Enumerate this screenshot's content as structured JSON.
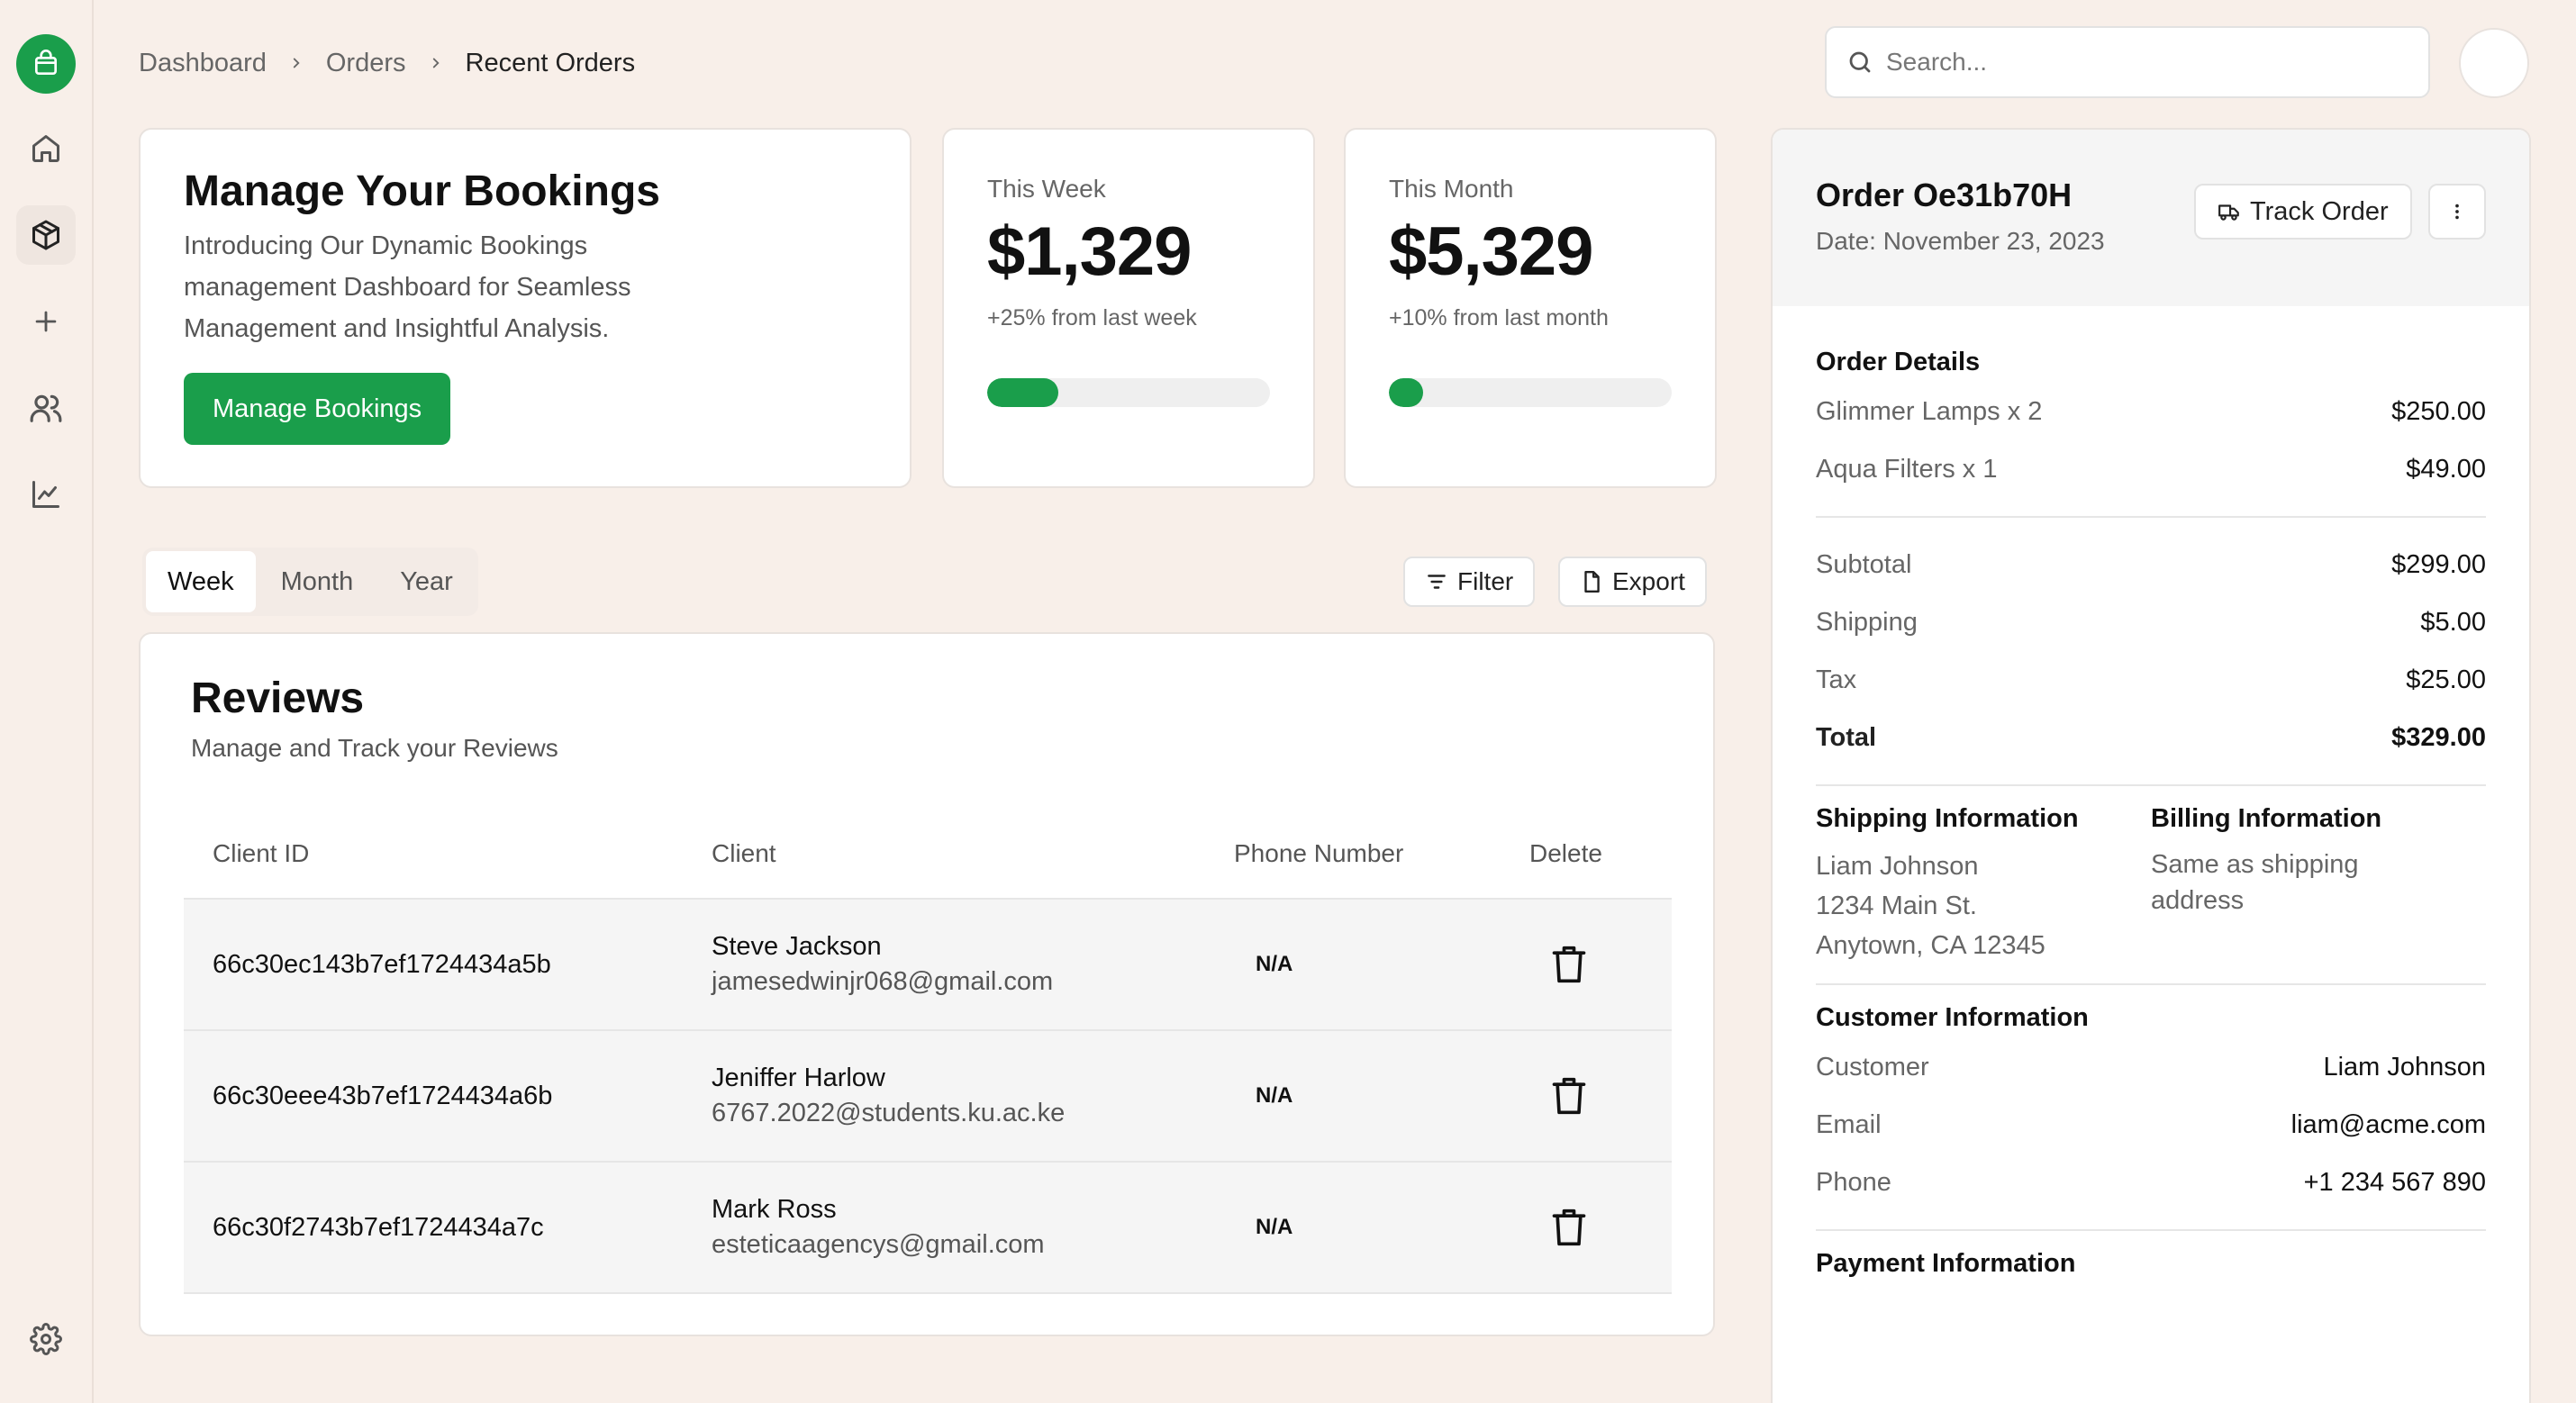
{
  "breadcrumb": [
    "Dashboard",
    "Orders",
    "Recent Orders"
  ],
  "search": {
    "placeholder": "Search..."
  },
  "hero": {
    "title": "Manage Your Bookings",
    "description": "Introducing Our Dynamic Bookings management Dashboard for Seamless Management and Insightful Analysis.",
    "button": "Manage Bookings"
  },
  "stats": [
    {
      "label": "This Week",
      "value": "$1,329",
      "change": "+25% from last week",
      "progress": 0.25
    },
    {
      "label": "This Month",
      "value": "$5,329",
      "change": "+10% from last month",
      "progress": 0.12
    }
  ],
  "tabs": [
    "Week",
    "Month",
    "Year"
  ],
  "toolbar": {
    "filter": "Filter",
    "export": "Export"
  },
  "reviews": {
    "title": "Reviews",
    "description": "Manage and Track your Reviews",
    "columns": [
      "Client ID",
      "Client",
      "Phone Number",
      "Delete"
    ],
    "rows": [
      {
        "id": "66c30ec143b7ef1724434a5b",
        "name": "Steve Jackson",
        "email": "jamesedwinjr068@gmail.com",
        "phone": "N/A"
      },
      {
        "id": "66c30eee43b7ef1724434a6b",
        "name": "Jeniffer Harlow",
        "email": "6767.2022@students.ku.ac.ke",
        "phone": "N/A"
      },
      {
        "id": "66c30f2743b7ef1724434a7c",
        "name": "Mark Ross",
        "email": "esteticaagencys@gmail.com",
        "phone": "N/A"
      }
    ]
  },
  "order": {
    "title": "Order Oe31b70H",
    "date": "Date: November 23, 2023",
    "track_button": "Track Order",
    "details_title": "Order Details",
    "items": [
      {
        "label": "Glimmer Lamps x 2",
        "value": "$250.00"
      },
      {
        "label": "Aqua Filters x 1",
        "value": "$49.00"
      }
    ],
    "totals": [
      {
        "label": "Subtotal",
        "value": "$299.00"
      },
      {
        "label": "Shipping",
        "value": "$5.00"
      },
      {
        "label": "Tax",
        "value": "$25.00"
      }
    ],
    "total": {
      "label": "Total",
      "value": "$329.00"
    },
    "shipping": {
      "title": "Shipping Information",
      "lines": [
        "Liam Johnson",
        "1234 Main St.",
        "Anytown, CA 12345"
      ]
    },
    "billing": {
      "title": "Billing Information",
      "lines": [
        "Same as shipping",
        "address"
      ]
    },
    "customer": {
      "title": "Customer Information",
      "rows": [
        {
          "label": "Customer",
          "value": "Liam Johnson"
        },
        {
          "label": "Email",
          "value": "liam@acme.com"
        },
        {
          "label": "Phone",
          "value": "+1 234 567 890"
        }
      ]
    },
    "payment_title": "Payment Information"
  },
  "colors": {
    "accent": "#1a9e4b",
    "background": "#f8efe9"
  },
  "icons": [
    "shopping-bag-icon",
    "home-icon",
    "package-icon",
    "plus-icon",
    "users-icon",
    "chart-icon",
    "settings-icon",
    "search-icon",
    "filter-icon",
    "file-icon",
    "truck-icon",
    "more-vertical-icon",
    "trash-icon"
  ]
}
